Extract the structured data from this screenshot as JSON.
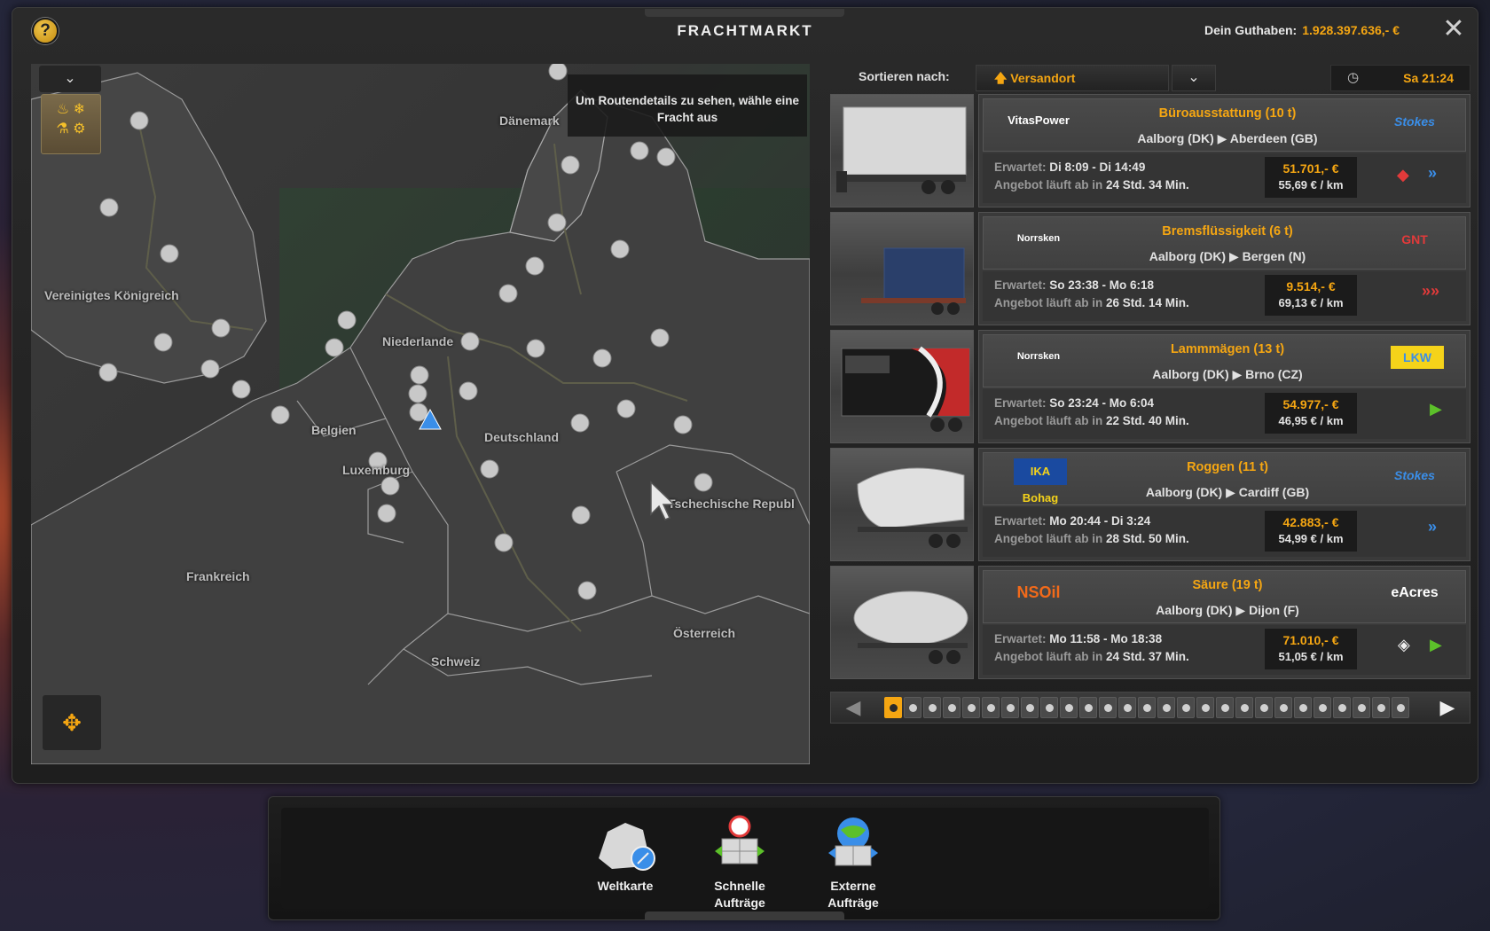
{
  "window": {
    "title": "FRACHTMARKT",
    "help_label": "?",
    "close_label": "✕",
    "balance_label": "Dein Guthaben:",
    "balance_value": "1.928.397.636,- €"
  },
  "map": {
    "tooltip": "Um Routendetails zu sehen, wähle eine Fracht aus",
    "dropdown_icon": "chevron-down-icon",
    "labels": {
      "daenemark": "Dänemark",
      "uk": "Vereinigtes Königreich",
      "niederlande": "Niederlande",
      "belgien": "Belgien",
      "deutschland": "Deutschland",
      "luxemburg": "Luxemburg",
      "tschechien": "Tschechische Republ",
      "frankreich": "Frankreich",
      "oesterreich": "Österreich",
      "schweiz": "Schweiz"
    }
  },
  "sort": {
    "label": "Sortieren nach:",
    "value": "Versandort"
  },
  "clock": {
    "time": "Sa 21:24"
  },
  "cargo": [
    {
      "name": "Büroausstattung (10 t)",
      "from": "Aalborg (DK)",
      "to": "Aberdeen (GB)",
      "company": "VitasPower",
      "client": "Stokes",
      "expected_label": "Erwartet:",
      "expected": "Di 8:09 - Di 14:49",
      "offer_label": "Angebot läuft ab in",
      "offer": "24 Std. 34 Min.",
      "price": "51.701,- €",
      "per_km": "55,69 € / km",
      "urgency": "fast",
      "special": "hazard"
    },
    {
      "name": "Bremsflüssigkeit (6 t)",
      "from": "Aalborg (DK)",
      "to": "Bergen (N)",
      "company": "Norrsken",
      "client": "GNT",
      "expected_label": "Erwartet:",
      "expected": "So 23:38 - Mo 6:18",
      "offer_label": "Angebot läuft ab in",
      "offer": "26 Std. 14 Min.",
      "price": "9.514,- €",
      "per_km": "69,13 € / km",
      "urgency": "urgent",
      "special": ""
    },
    {
      "name": "Lammmägen (13 t)",
      "from": "Aalborg (DK)",
      "to": "Brno (CZ)",
      "company": "Norrsken",
      "client": "LKW",
      "expected_label": "Erwartet:",
      "expected": "So 23:24 - Mo 6:04",
      "offer_label": "Angebot läuft ab in",
      "offer": "22 Std. 40 Min.",
      "price": "54.977,- €",
      "per_km": "46,95 € / km",
      "urgency": "standard",
      "special": ""
    },
    {
      "name": "Roggen (11 t)",
      "from": "Aalborg (DK)",
      "to": "Cardiff (GB)",
      "company": "IKA Bohag",
      "client": "Stokes",
      "expected_label": "Erwartet:",
      "expected": "Mo 20:44 - Di 3:24",
      "offer_label": "Angebot läuft ab in",
      "offer": "28 Std. 50 Min.",
      "price": "42.883,- €",
      "per_km": "54,99 € / km",
      "urgency": "fast",
      "special": ""
    },
    {
      "name": "Säure (19 t)",
      "from": "Aalborg (DK)",
      "to": "Dijon (F)",
      "company": "NSOil",
      "client": "eAcres",
      "expected_label": "Erwartet:",
      "expected": "Mo 11:58 - Mo 18:38",
      "offer_label": "Angebot läuft ab in",
      "offer": "24 Std. 37 Min.",
      "price": "71.010,- €",
      "per_km": "51,05 € / km",
      "urgency": "standard",
      "special": "fragile"
    }
  ],
  "pager": {
    "pages": 27,
    "current": 1
  },
  "dock": {
    "buttons": [
      {
        "line1": "Weltkarte",
        "line2": ""
      },
      {
        "line1": "Schnelle",
        "line2": "Aufträge"
      },
      {
        "line1": "Externe",
        "line2": "Aufträge"
      }
    ]
  },
  "colors": {
    "accent": "#f5a612",
    "panel": "#2a2a2a",
    "urgent": "#e23a3a",
    "fast": "#3a8ee8",
    "standard": "#5cc02a"
  }
}
